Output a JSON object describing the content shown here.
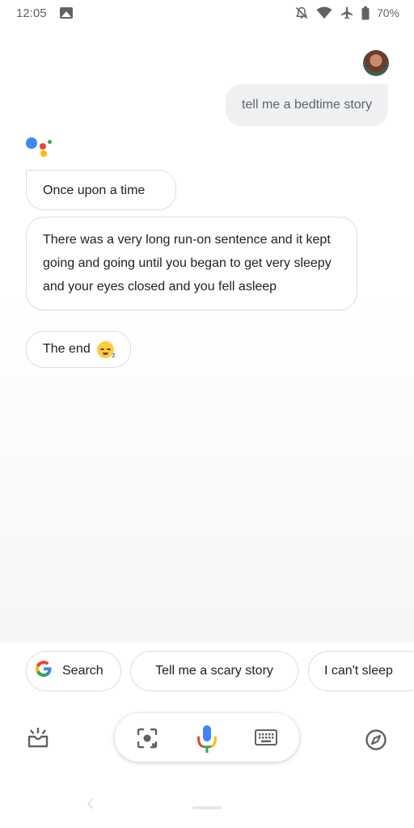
{
  "status_bar": {
    "time": "12:05",
    "battery_text": "70%",
    "icons": [
      "gallery-icon",
      "notifications-off-icon",
      "wifi-icon",
      "airplane-mode-icon",
      "battery-icon"
    ]
  },
  "conversation": {
    "user_message": "tell me a bedtime story",
    "assistant_messages": [
      "Once upon a time",
      "There was a very long run-on sentence and it kept going and going until you began to get very sleepy and your eyes closed and you fell asleep",
      "The end"
    ],
    "emoji": "sleeping-face"
  },
  "suggestions": {
    "search_label": "Search",
    "chip_2": "Tell me a scary story",
    "chip_3": "I can't sleep"
  },
  "bottom_bar": {
    "icons": [
      "updates-inbox-icon",
      "lens-icon",
      "mic-icon",
      "keyboard-icon",
      "explore-icon"
    ]
  },
  "colors": {
    "google_blue": "#4285f4",
    "google_red": "#ea4335",
    "google_yellow": "#fbbc05",
    "google_green": "#34a853",
    "bubble_grey": "#eff0f2"
  }
}
